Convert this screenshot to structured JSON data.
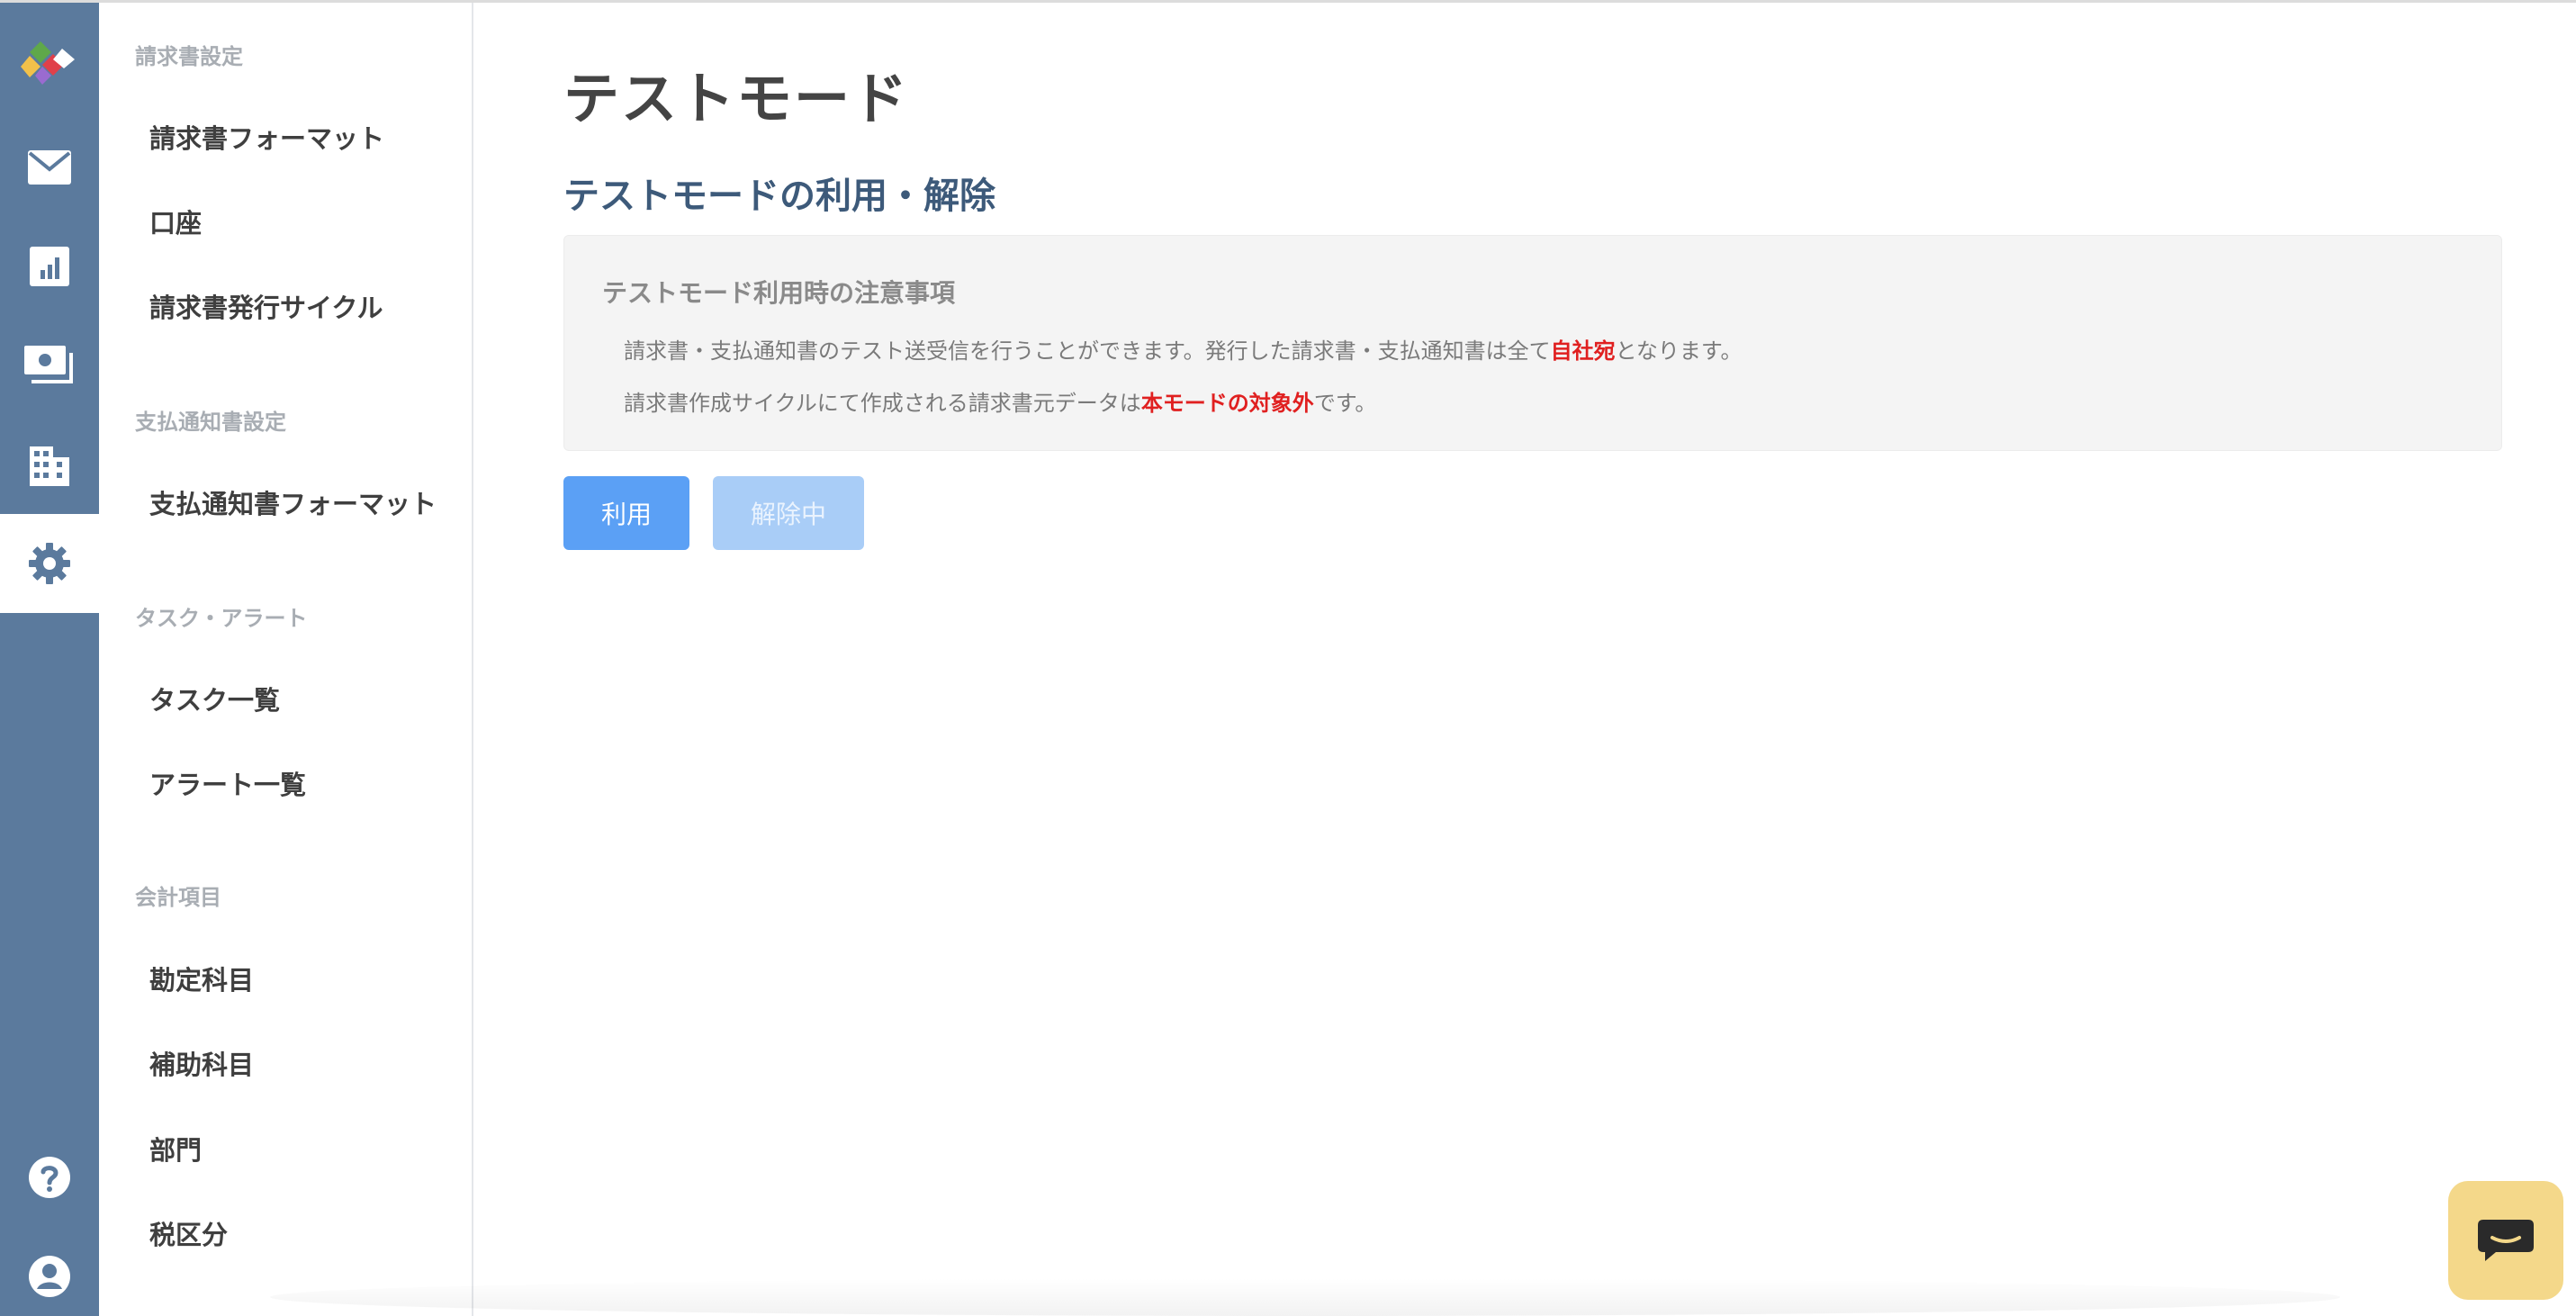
{
  "sidebar": {
    "sections": [
      {
        "label": "請求書設定",
        "items": [
          "請求書フォーマット",
          "口座",
          "請求書発行サイクル"
        ]
      },
      {
        "label": "支払通知書設定",
        "items": [
          "支払通知書フォーマット"
        ]
      },
      {
        "label": "タスク・アラート",
        "items": [
          "タスク一覧",
          "アラート一覧"
        ]
      },
      {
        "label": "会計項目",
        "items": [
          "勘定科目",
          "補助科目",
          "部門",
          "税区分"
        ]
      }
    ]
  },
  "rail": {
    "icons": [
      "logo-icon",
      "mail-icon",
      "report-icon",
      "money-icon",
      "building-icon",
      "gear-icon",
      "help-icon",
      "account-icon"
    ],
    "active": "gear-icon"
  },
  "main": {
    "title": "テストモード",
    "section_title": "テストモードの利用・解除",
    "notice": {
      "title": "テストモード利用時の注意事項",
      "line1_pre": "請求書・支払通知書のテスト送受信を行うことができます。発行した請求書・支払通知書は全て",
      "line1_hl": "自社宛",
      "line1_post": "となります。",
      "line2_pre": "請求書作成サイクルにて作成される請求書元データは",
      "line2_hl": "本モードの対象外",
      "line2_post": "です。"
    },
    "buttons": {
      "use": "利用",
      "release": "解除中"
    }
  },
  "colors": {
    "rail": "#5b7a9d",
    "primary": "#5ba0f5",
    "highlight": "#e02020",
    "chat": "#f4d88a"
  }
}
